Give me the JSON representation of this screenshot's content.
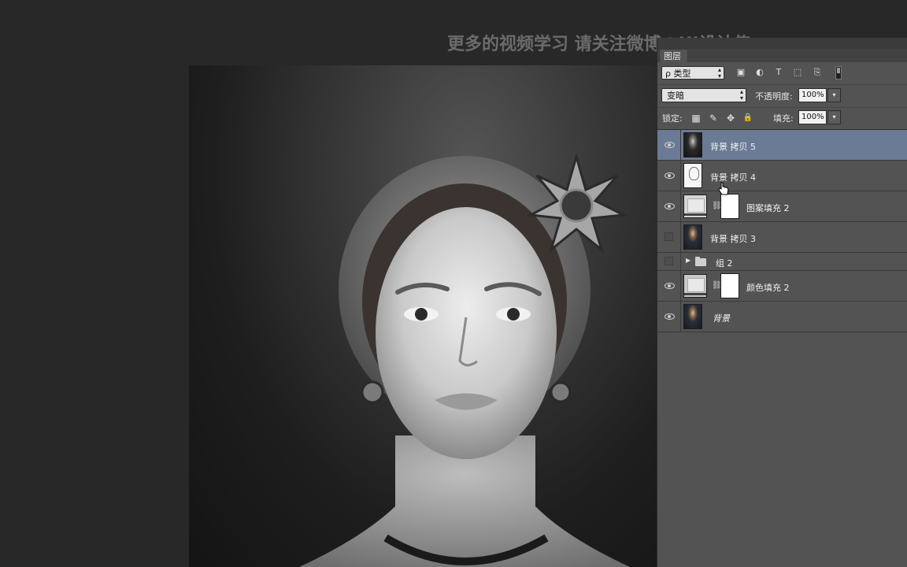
{
  "watermark": {
    "text": "更多的视频学习 请关注微博@UI设计传"
  },
  "panel": {
    "tab_label": "图层",
    "filter": {
      "select_label": "ρ 类型",
      "icons": [
        "image-filter-icon",
        "adjustment-filter-icon",
        "text-filter-icon",
        "shape-filter-icon",
        "smart-object-filter-icon"
      ],
      "icon_glyphs": [
        "▣",
        "◐",
        "T",
        "⬚",
        "⎘"
      ]
    },
    "blend": {
      "mode": "变暗",
      "opacity_label": "不透明度:",
      "opacity_value": "100%"
    },
    "lock": {
      "label": "锁定:",
      "icons": [
        "lock-transparent-icon",
        "lock-paint-icon",
        "lock-move-icon",
        "lock-all-icon"
      ],
      "icon_glyphs": [
        "▦",
        "✎",
        "✥",
        "🔒"
      ],
      "fill_label": "填充:",
      "fill_value": "100%"
    },
    "layers": [
      {
        "name": "背景 拷贝 5",
        "visible": true,
        "selected": true,
        "kind": "photo-bw"
      },
      {
        "name": "背景 拷贝 4",
        "visible": true,
        "selected": false,
        "kind": "sketch"
      },
      {
        "name": "图案填充 2",
        "visible": true,
        "selected": false,
        "kind": "fill"
      },
      {
        "name": "背景 拷贝 3",
        "visible": false,
        "selected": false,
        "kind": "photo"
      },
      {
        "name": "组 2",
        "visible": false,
        "selected": false,
        "kind": "group"
      },
      {
        "name": "颜色填充 2",
        "visible": true,
        "selected": false,
        "kind": "fill"
      },
      {
        "name": "背景",
        "visible": true,
        "selected": false,
        "kind": "photo"
      }
    ]
  },
  "colors": {
    "selected_row": "#6b7b95",
    "panel_bg": "#535353",
    "workspace_bg": "#282828"
  }
}
